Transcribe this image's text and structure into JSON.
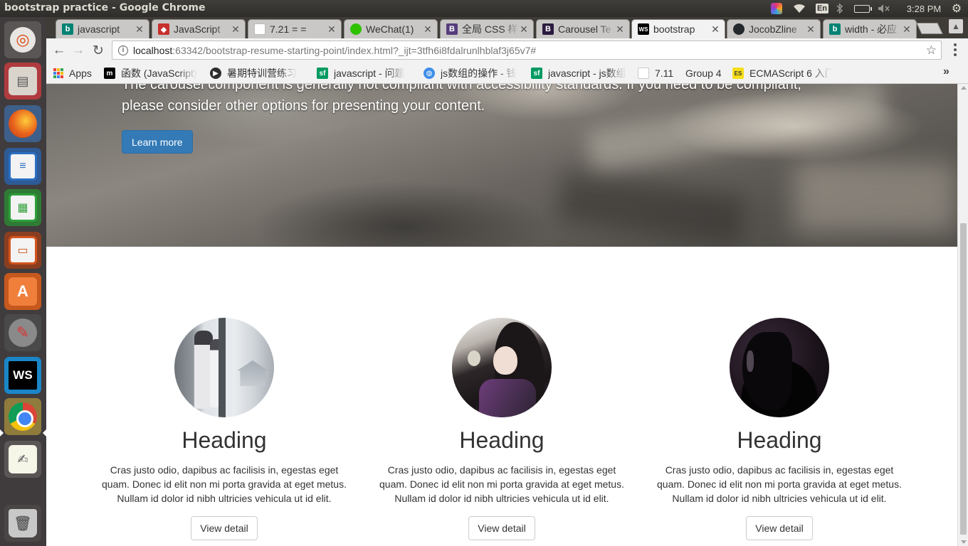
{
  "window": {
    "title": "bootstrap practice - Google Chrome"
  },
  "panel": {
    "input_method": "En",
    "clock": "3:28 PM"
  },
  "launcher": {
    "items": [
      "ubuntu-dash",
      "files",
      "firefox",
      "libreoffice-writer",
      "libreoffice-calc",
      "libreoffice-impress",
      "ubuntu-software",
      "system-settings",
      "webstorm",
      "chrome",
      "text-editor",
      "trash"
    ]
  },
  "tabs": [
    {
      "label": "javascript",
      "favicon": "bing-icon",
      "favicon_color": "#008373",
      "active": false
    },
    {
      "label": "JavaScript",
      "favicon": "runoob-icon",
      "favicon_color": "#c8302c",
      "active": false
    },
    {
      "label": "7.21 = =",
      "favicon": "page-icon",
      "favicon_color": "#ffffff",
      "active": false
    },
    {
      "label": "WeChat(1)",
      "favicon": "wechat-icon",
      "favicon_color": "#2dc100",
      "active": false
    },
    {
      "label": "全局 CSS 样",
      "favicon": "bootstrap-icon",
      "favicon_color": "#563d7c",
      "active": false
    },
    {
      "label": "Carousel Te",
      "favicon": "bootstrap-icon",
      "favicon_color": "#2b1b3f",
      "active": false
    },
    {
      "label": "bootstrap",
      "favicon": "webstorm-icon",
      "favicon_color": "#000000",
      "active": true
    },
    {
      "label": "JocobZline",
      "favicon": "github-icon",
      "favicon_color": "#24292e",
      "active": false
    },
    {
      "label": "width - 必应",
      "favicon": "bing-icon",
      "favicon_color": "#008373",
      "active": false
    }
  ],
  "omnibox": {
    "host": "localhost",
    "rest": ":63342/bootstrap-resume-starting-point/index.html?_ijt=3tfh6i8fdalrunlhblaf3j65v7#"
  },
  "bookmarks": [
    {
      "label": "Apps",
      "icon": "apps-grid-icon"
    },
    {
      "label": "函数 (JavaScript)",
      "icon": "mdn-icon",
      "color": "#000000"
    },
    {
      "label": "暑期特训营练习",
      "icon": "play-icon",
      "color": "#2d2d2d"
    },
    {
      "label": "javascript - 问题",
      "icon": "segmentfault-icon",
      "color": "#009a61"
    },
    {
      "label": "js数组的操作 - 钱",
      "icon": "globe-icon",
      "color": "#3d8ee8"
    },
    {
      "label": "javascript - js数组",
      "icon": "segmentfault-icon",
      "color": "#009a61"
    },
    {
      "label": "7.11",
      "icon": "page-icon",
      "color": "#ffffff"
    },
    {
      "label": "Group 4",
      "icon": "none"
    },
    {
      "label": "ECMAScript 6 入门",
      "icon": "es-icon",
      "color": "#f5de19"
    }
  ],
  "page": {
    "carousel": {
      "caption": "The carousel component is generally not compliant with accessibility standards. If you need to be compliant, please consider other options for presenting your content.",
      "button_label": "Learn more"
    },
    "columns": [
      {
        "heading": "Heading",
        "text": "Cras justo odio, dapibus ac facilisis in, egestas eget quam. Donec id elit non mi porta gravida at eget metus. Nullam id dolor id nibh ultricies vehicula ut id elit.",
        "button_label": "View detail"
      },
      {
        "heading": "Heading",
        "text": "Cras justo odio, dapibus ac facilisis in, egestas eget quam. Donec id elit non mi porta gravida at eget metus. Nullam id dolor id nibh ultricies vehicula ut id elit.",
        "button_label": "View detail"
      },
      {
        "heading": "Heading",
        "text": "Cras justo odio, dapibus ac facilisis in, egestas eget quam. Donec id elit non mi porta gravida at eget metus. Nullam id dolor id nibh ultricies vehicula ut id elit.",
        "button_label": "View detail"
      }
    ]
  },
  "colors": {
    "primary_button": "#337ab7",
    "text": "#333333",
    "panel": "#3c3b37",
    "launcher": "#403c3d"
  }
}
